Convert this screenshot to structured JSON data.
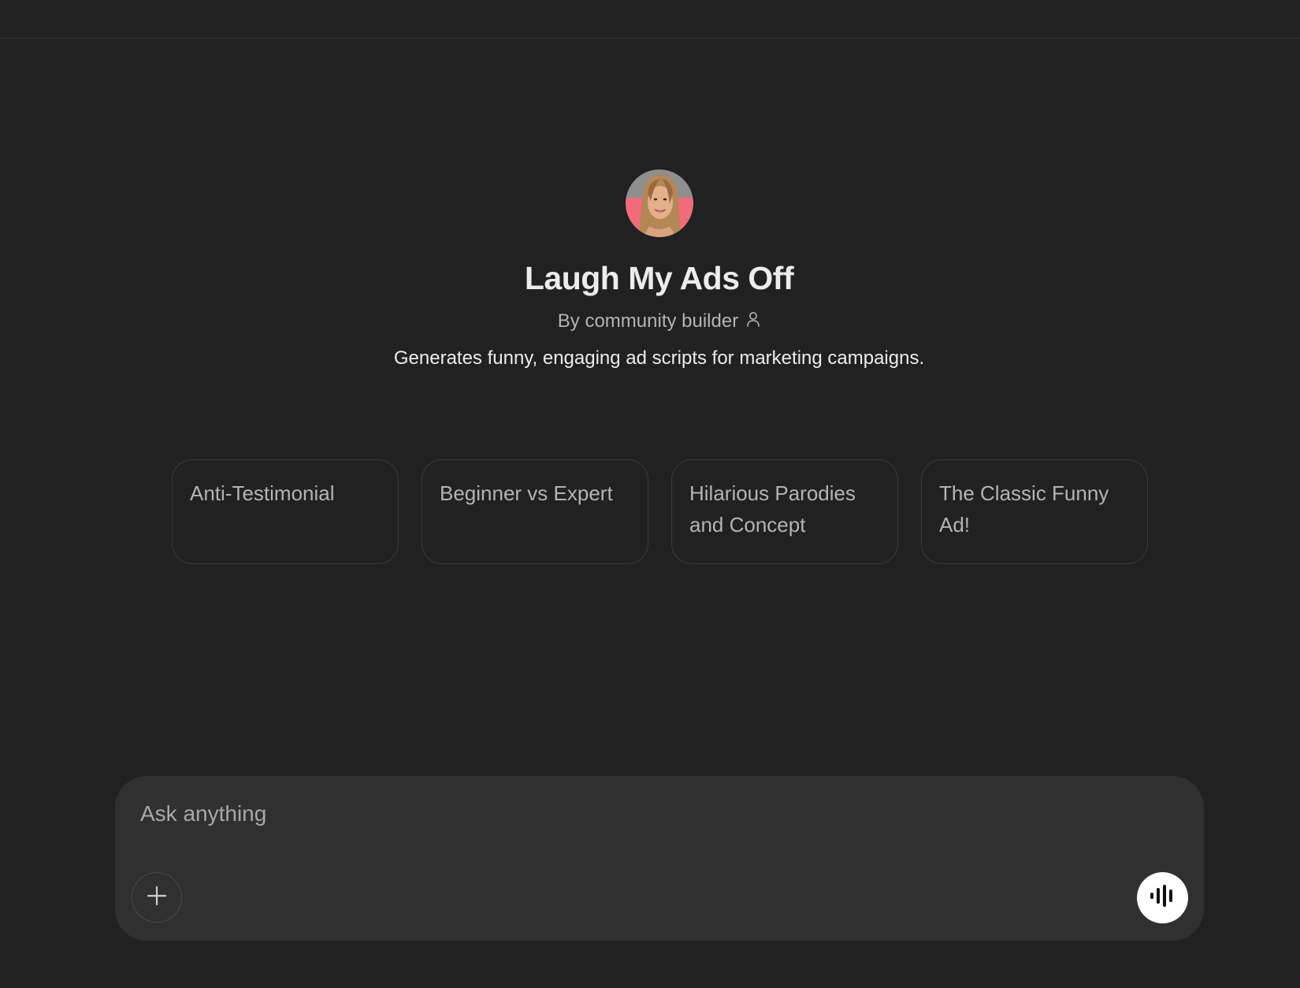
{
  "gpt": {
    "name": "Laugh My Ads Off",
    "byline": "By community builder",
    "description": "Generates funny, engaging ad scripts for marketing campaigns.",
    "avatar_icon": "profile-photo"
  },
  "conversation_starters": [
    {
      "label": "Anti-Testimonial"
    },
    {
      "label": "Beginner vs Expert"
    },
    {
      "label": "Hilarious Parodies and Concept"
    },
    {
      "label": "The Classic Funny Ad!"
    }
  ],
  "composer": {
    "placeholder": "Ask anything",
    "add_icon": "plus-icon",
    "voice_icon": "voice-waveform-icon"
  },
  "colors": {
    "background": "#212121",
    "composer": "#303030",
    "avatar_accent": "#f26b7a"
  }
}
